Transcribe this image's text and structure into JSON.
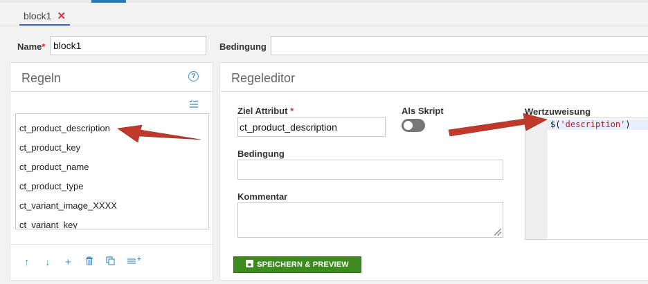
{
  "tabs": [
    {
      "label": "block1",
      "close_icon": "close-icon"
    }
  ],
  "form": {
    "name_label": "Name",
    "required_mark": "*",
    "name_value": "block1",
    "condition_label": "Bedingung",
    "condition_value": ""
  },
  "rules_panel": {
    "title": "Regeln",
    "help_icon": "help-circle-icon",
    "help_glyph": "?",
    "items": [
      "ct_product_description",
      "ct_product_key",
      "ct_product_name",
      "ct_product_type",
      "ct_variant_image_XXXX",
      "ct_variant_key"
    ],
    "footer_icons": [
      "arrow-up-icon",
      "arrow-down-icon",
      "plus-icon",
      "trash-icon",
      "duplicate-icon",
      "list-add-icon"
    ]
  },
  "editor": {
    "title": "Regeleditor",
    "target_label": "Ziel Attribut",
    "target_value": "ct_product_description",
    "as_script_label": "Als Skript",
    "as_script_on": false,
    "condition_label": "Bedingung",
    "condition_value": "",
    "comment_label": "Kommentar",
    "comment_value": "",
    "assignment_label": "Wertzuweisung",
    "code_prefix": "$(",
    "code_string": "'description'",
    "code_suffix": ")",
    "save_button": "SPEICHERN & PREVIEW",
    "save_icon": "floppy-disk-icon"
  },
  "colors": {
    "accent_blue": "#3b8fd1",
    "tab_underline": "#4a5bb8",
    "required_red": "#e0242b",
    "save_green": "#3c8a1e",
    "annotation_arrow": "#c0392b"
  }
}
